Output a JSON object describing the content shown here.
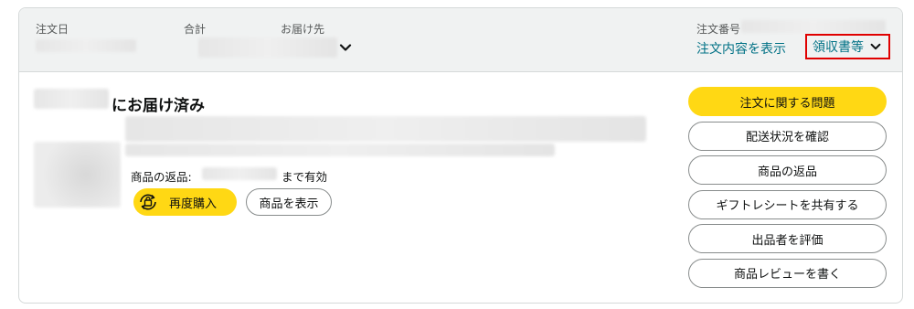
{
  "header": {
    "order_date_label": "注文日",
    "total_label": "合計",
    "ship_to_label": "お届け先",
    "order_number_label": "注文番号",
    "view_order_details": "注文内容を表示",
    "receipt_label": "領収書等"
  },
  "shipment": {
    "status_suffix": "にお届け済み",
    "return_label": "商品の返品:",
    "return_until": "まで有効",
    "buy_again": "再度購入",
    "view_item": "商品を表示"
  },
  "actions": [
    {
      "label": "注文に関する問題"
    },
    {
      "label": "配送状況を確認"
    },
    {
      "label": "商品の返品"
    },
    {
      "label": "ギフトレシートを共有する"
    },
    {
      "label": "出品者を評価"
    },
    {
      "label": "商品レビューを書く"
    }
  ],
  "colors": {
    "primary_button": "#ffd814",
    "link": "#007185",
    "highlight_border": "#e00000",
    "header_bg": "#f0f2f2"
  },
  "icons": {
    "ship_to_dropdown": "chevron-down-icon",
    "receipt_dropdown": "chevron-down-icon",
    "buy_again": "rebuy-bag-icon"
  }
}
